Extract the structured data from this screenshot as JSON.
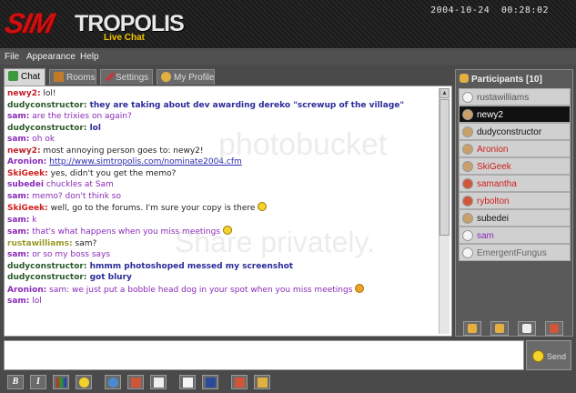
{
  "header": {
    "logo_sim": "SIM",
    "logo_tropolis": "TROPOLIS",
    "logo_sub": "Live Chat",
    "date": "2004-10-24",
    "time": "00:28:02"
  },
  "menu": [
    "File",
    "Appearance",
    "Help"
  ],
  "tabs": [
    {
      "label": "Chat",
      "icon": "chat-icon",
      "active": true
    },
    {
      "label": "Rooms",
      "icon": "rooms-icon",
      "active": false
    },
    {
      "label": "Settings",
      "icon": "settings-icon",
      "active": false
    },
    {
      "label": "My Profile",
      "icon": "profile-icon",
      "active": false
    }
  ],
  "messages": [
    {
      "nick": "newy2:",
      "nick_color": "#c0202a",
      "text": " lol!",
      "text_color": "#222",
      "bold": false
    },
    {
      "nick": "dudyconstructor:",
      "nick_color": "#2a5a2a",
      "text": " they are taking about dev awarding dereko \"screwup of the village\"",
      "text_color": "#2a2a9a",
      "bold": true
    },
    {
      "nick": "sam:",
      "nick_color": "#8a2ab8",
      "text": " are the trixies on again?",
      "text_color": "#8a2ab8",
      "bold": false
    },
    {
      "nick": "dudyconstructor:",
      "nick_color": "#2a5a2a",
      "text": " lol",
      "text_color": "#2a2a9a",
      "bold": true
    },
    {
      "nick": "sam:",
      "nick_color": "#8a2ab8",
      "text": " oh ok",
      "text_color": "#8a2ab8",
      "bold": false
    },
    {
      "nick": "newy2:",
      "nick_color": "#c0202a",
      "text": " most annoying person goes to: newy2!",
      "text_color": "#222",
      "bold": false
    },
    {
      "nick": "Aronion:",
      "nick_color": "#8a2ab8",
      "text": " ",
      "text_color": "#222",
      "bold": false,
      "link": "http://www.simtropolis.com/nominate2004.cfm"
    },
    {
      "nick": "SkiGeek:",
      "nick_color": "#d02020",
      "text": " yes, didn't you get the memo?",
      "text_color": "#222",
      "bold": false
    },
    {
      "nick": "subedei",
      "nick_color": "#8a2ab8",
      "text": " chuckles at Sam",
      "text_color": "#8a2ab8",
      "bold": false
    },
    {
      "nick": "sam:",
      "nick_color": "#8a2ab8",
      "text": " memo? don't think so",
      "text_color": "#8a2ab8",
      "bold": false
    },
    {
      "nick": "SkiGeek:",
      "nick_color": "#d02020",
      "text": " well, go to the forums.  I'm sure your copy is there ",
      "text_color": "#222",
      "bold": false,
      "smiley": "smile"
    },
    {
      "nick": "sam:",
      "nick_color": "#8a2ab8",
      "text": " k",
      "text_color": "#8a2ab8",
      "bold": false
    },
    {
      "nick": "sam:",
      "nick_color": "#8a2ab8",
      "text": " that's what happens when you miss meetings ",
      "text_color": "#8a2ab8",
      "bold": false,
      "smiley": "smile"
    },
    {
      "nick": "rustawilliams:",
      "nick_color": "#9a9a2a",
      "text": " sam?",
      "text_color": "#222",
      "bold": false
    },
    {
      "nick": "sam:",
      "nick_color": "#8a2ab8",
      "text": " or so my boss says",
      "text_color": "#8a2ab8",
      "bold": false
    },
    {
      "nick": "dudyconstructor:",
      "nick_color": "#2a5a2a",
      "text": " hmmm photoshoped messed my screenshot",
      "text_color": "#2a2a9a",
      "bold": true
    },
    {
      "nick": "dudyconstructor:",
      "nick_color": "#2a5a2a",
      "text": " got blury",
      "text_color": "#2a2a9a",
      "bold": true
    },
    {
      "nick": "Aronion:",
      "nick_color": "#8a2ab8",
      "text": " sam: we just put a bobble head dog in your spot when you miss meetings ",
      "text_color": "#8a2ab8",
      "bold": false,
      "smiley": "tongue"
    },
    {
      "nick": "sam:",
      "nick_color": "#8a2ab8",
      "text": " lol",
      "text_color": "#8a2ab8",
      "bold": false
    }
  ],
  "participants": {
    "title": "Participants [10]",
    "items": [
      {
        "name": "rustawilliams",
        "color": "#555555",
        "selected": false,
        "avatar": "plain"
      },
      {
        "name": "newy2",
        "color": "#ffffff",
        "selected": true,
        "avatar": "dark"
      },
      {
        "name": "dudyconstructor",
        "color": "#111111",
        "selected": false,
        "avatar": "dark"
      },
      {
        "name": "Aronion",
        "color": "#d02020",
        "selected": false,
        "avatar": "dark"
      },
      {
        "name": "SkiGeek",
        "color": "#d02020",
        "selected": false,
        "avatar": "dark"
      },
      {
        "name": "samantha",
        "color": "#d02020",
        "selected": false,
        "avatar": "red"
      },
      {
        "name": "rybolton",
        "color": "#d02020",
        "selected": false,
        "avatar": "red"
      },
      {
        "name": "subedei",
        "color": "#111111",
        "selected": false,
        "avatar": "dark"
      },
      {
        "name": "sam",
        "color": "#8a2ab8",
        "selected": false,
        "avatar": "plain"
      },
      {
        "name": "EmergentFungus",
        "color": "#666666",
        "selected": false,
        "avatar": "plain"
      }
    ]
  },
  "input": {
    "value": "",
    "send_label": "Send"
  },
  "watermark": {
    "line1": "photobucket",
    "line2": "Share privately."
  }
}
